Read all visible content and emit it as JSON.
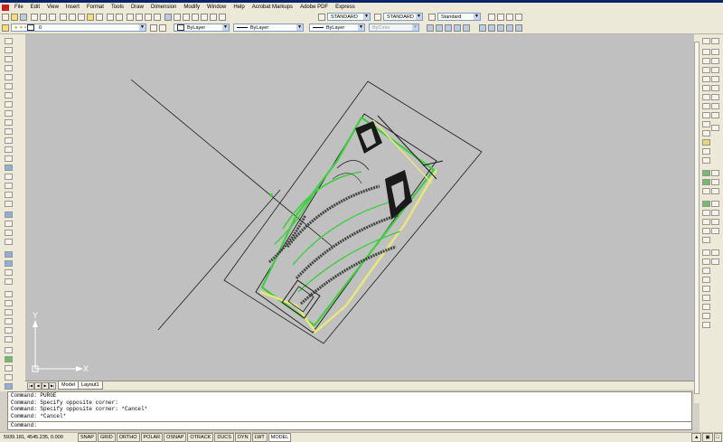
{
  "menu": {
    "items": [
      "File",
      "Edit",
      "View",
      "Insert",
      "Format",
      "Tools",
      "Draw",
      "Dimension",
      "Modify",
      "Window",
      "Help",
      "Acrobat Markups",
      "Adobe PDF",
      "Express"
    ]
  },
  "styles_toolbar": {
    "text_style": "STANDARD",
    "dim_style": "STANDARD",
    "table_style": "Standard"
  },
  "layers_toolbar": {
    "current_layer": "0",
    "color": "ByLayer",
    "linetype": "ByLayer",
    "lineweight": "ByLayer",
    "plot_style": "ByColor"
  },
  "tabs": [
    "Model",
    "Layout1"
  ],
  "active_tab": "Model",
  "ucs": {
    "x_label": "X",
    "y_label": "Y"
  },
  "command": {
    "history": [
      "Command: PURGE",
      "Command: Specify opposite corner:",
      "Command: Specify opposite corner: *Cancel*",
      "Command: *Cancel*"
    ],
    "prompt": "Command:"
  },
  "status": {
    "coordinates": "5939.181, 4545.235, 0.000",
    "toggles": [
      "SNAP",
      "GRID",
      "ORTHO",
      "POLAR",
      "OSNAP",
      "OTRACK",
      "DUCS",
      "DYN",
      "LWT",
      "MODEL"
    ]
  },
  "colors": {
    "canvas_bg": "#c0c0c0",
    "green_layer": "#3ecf3e",
    "yellow_layer": "#e8e878",
    "linework": "#1a1a1a"
  }
}
